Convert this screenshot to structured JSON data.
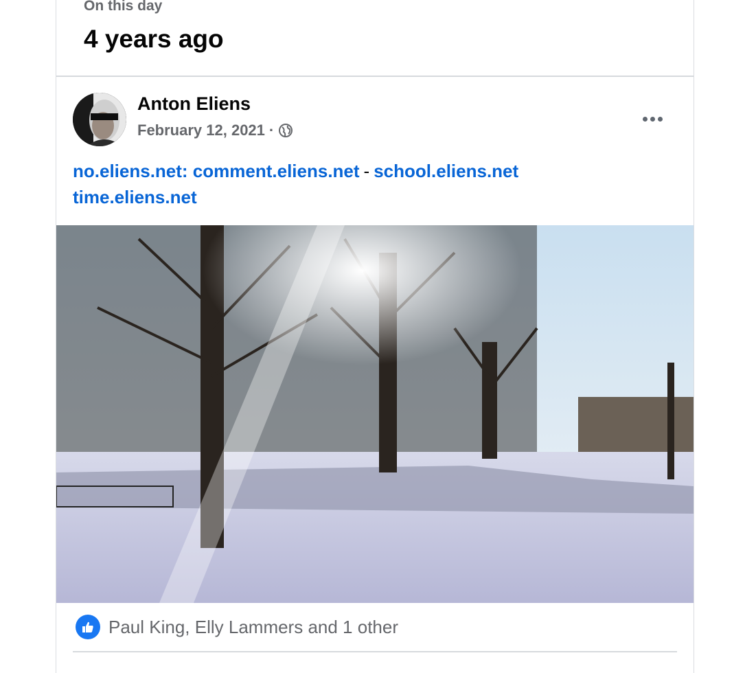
{
  "memory": {
    "section_label": "On this day",
    "time_ago": "4 years ago"
  },
  "post": {
    "author": "Anton Eliens",
    "date": "February 12, 2021",
    "separator": "·",
    "privacy_icon": "globe-icon",
    "more_icon": "more-options-icon",
    "links": [
      "no.eliens.net: comment.eliens.net",
      "-",
      "school.eliens.net",
      "time.eliens.net"
    ],
    "photo_alt": "Snowy park with sunlight through bare trees"
  },
  "reactions": {
    "icon": "like-icon",
    "text": "Paul King, Elly Lammers and 1 other"
  },
  "colors": {
    "link": "#0865d6",
    "like": "#1877f2",
    "muted": "#65676b"
  }
}
